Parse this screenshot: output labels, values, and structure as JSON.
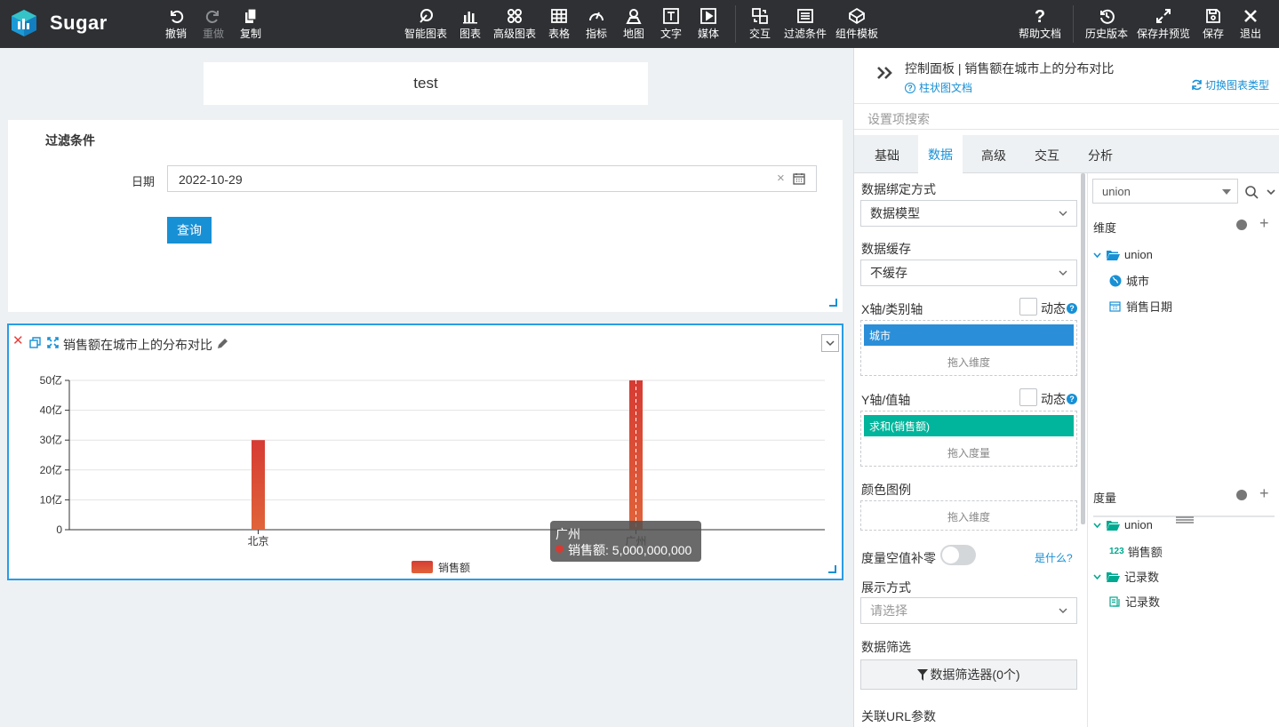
{
  "app": {
    "name": "Sugar",
    "brand_color": "#2ea3f2"
  },
  "toolbar": {
    "left": [
      {
        "label": "撤销",
        "icon": "undo-icon"
      },
      {
        "label": "重做",
        "icon": "redo-icon",
        "disabled": true
      },
      {
        "label": "复制",
        "icon": "copy-icon"
      }
    ],
    "center": [
      {
        "label": "智能图表",
        "icon": "smart-chart-icon"
      },
      {
        "label": "图表",
        "icon": "bar-chart-icon"
      },
      {
        "label": "高级图表",
        "icon": "advanced-chart-icon"
      },
      {
        "label": "表格",
        "icon": "table-icon"
      },
      {
        "label": "指标",
        "icon": "gauge-icon"
      },
      {
        "label": "地图",
        "icon": "map-icon"
      },
      {
        "label": "文字",
        "icon": "text-icon"
      },
      {
        "label": "媒体",
        "icon": "media-icon"
      },
      {
        "label": "交互",
        "icon": "interaction-icon"
      },
      {
        "label": "过滤条件",
        "icon": "filter-condition-icon"
      },
      {
        "label": "组件模板",
        "icon": "component-template-icon"
      }
    ],
    "right": [
      {
        "label": "帮助文档",
        "icon": "help-icon"
      },
      {
        "label": "历史版本",
        "icon": "history-icon"
      },
      {
        "label": "保存并预览",
        "icon": "expand-icon"
      },
      {
        "label": "保存",
        "icon": "save-icon"
      },
      {
        "label": "退出",
        "icon": "close-icon"
      }
    ]
  },
  "canvas": {
    "title_text": "test",
    "filter": {
      "heading": "过滤条件",
      "date_label": "日期",
      "date_value": "2022-10-29",
      "query_button": "查询"
    },
    "chart": {
      "title": "销售额在城市上的分布对比",
      "chart_data": {
        "type": "bar",
        "categories": [
          "北京",
          "广州"
        ],
        "series": [
          {
            "name": "销售额",
            "values": [
              3000000000,
              5000000000
            ]
          }
        ],
        "ylim": [
          0,
          5000000000
        ],
        "y_ticks": [
          "0",
          "10亿",
          "20亿",
          "30亿",
          "40亿",
          "50亿"
        ],
        "y_tick_values": [
          0,
          1000000000,
          2000000000,
          3000000000,
          4000000000,
          5000000000
        ],
        "grid": true,
        "legend": "bottom",
        "bar_colors": [
          "#d63b33",
          "#e0643a"
        ],
        "tooltip": {
          "title": "广州",
          "series": "销售额",
          "value": "5,000,000,000"
        }
      }
    }
  },
  "panel": {
    "header_title": "控制面板 | 销售额在城市上的分布对比",
    "doc_link": "柱状图文档",
    "switch_link": "切换图表类型",
    "search_placeholder": "设置项搜索",
    "tabs": [
      {
        "label": "基础",
        "active": false
      },
      {
        "label": "数据",
        "active": true
      },
      {
        "label": "高级",
        "active": false
      },
      {
        "label": "交互",
        "active": false
      },
      {
        "label": "分析",
        "active": false
      }
    ],
    "binding_label": "数据绑定方式",
    "binding_value": "数据模型",
    "cache_label": "数据缓存",
    "cache_value": "不缓存",
    "x_axis_label": "X轴/类别轴",
    "x_dynamic": "动态",
    "x_pill": "城市",
    "x_drop_hint": "拖入维度",
    "y_axis_label": "Y轴/值轴",
    "y_dynamic": "动态",
    "y_pill": "求和(销售额)",
    "y_drop_hint": "拖入度量",
    "color_label": "颜色图例",
    "color_drop_hint": "拖入维度",
    "zero_fill_label": "度量空值补零",
    "whats_this": "是什么?",
    "display_label": "展示方式",
    "display_placeholder": "请选择",
    "data_filter_label": "数据筛选",
    "data_filter_button": "数据筛选器(0个)",
    "url_param_label": "关联URL参数",
    "colors": {
      "accent": "#1890d5",
      "x_pill": "#2a8fd8",
      "y_pill": "#00b59b"
    }
  },
  "fields": {
    "model_select": "union",
    "dimension_title": "维度",
    "dimension_group": "union",
    "dimensions": [
      "城市",
      "销售日期"
    ],
    "measure_title": "度量",
    "measure_group": "union",
    "measures": [
      "销售额"
    ],
    "count_group": "记录数",
    "count_items": [
      "记录数"
    ]
  }
}
